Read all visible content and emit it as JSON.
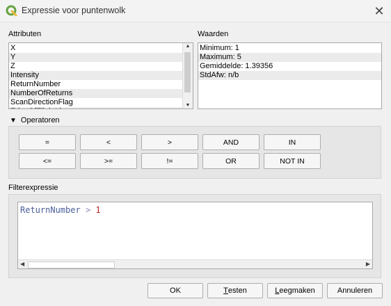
{
  "window": {
    "title": "Expressie voor puntenwolk",
    "close_glyph": "✕",
    "app_icon": "qgis-icon",
    "accent_color": "#65a33f"
  },
  "attributes": {
    "label": "Attributen",
    "items": [
      "X",
      "Y",
      "Z",
      "Intensity",
      "ReturnNumber",
      "NumberOfReturns",
      "ScanDirectionFlag",
      "EdgeOfFlightLine"
    ]
  },
  "values": {
    "label": "Waarden",
    "items": [
      "Minimum: 1",
      "Maximum: 5",
      "Gemiddelde: 1.39356",
      "StdAfw: n/b"
    ]
  },
  "operators": {
    "label": "Operatoren",
    "row1": [
      "=",
      "<",
      ">",
      "AND",
      "IN"
    ],
    "row2": [
      "<=",
      ">=",
      "!=",
      "OR",
      "NOT IN"
    ]
  },
  "filter": {
    "label": "Filterexpressie",
    "tokens": {
      "field": "ReturnNumber",
      "op": ">",
      "value": "1"
    }
  },
  "buttons": {
    "ok": "OK",
    "test_first": "T",
    "test_rest": "esten",
    "clear_first": "L",
    "clear_rest": "eegmaken",
    "cancel": "Annuleren"
  }
}
